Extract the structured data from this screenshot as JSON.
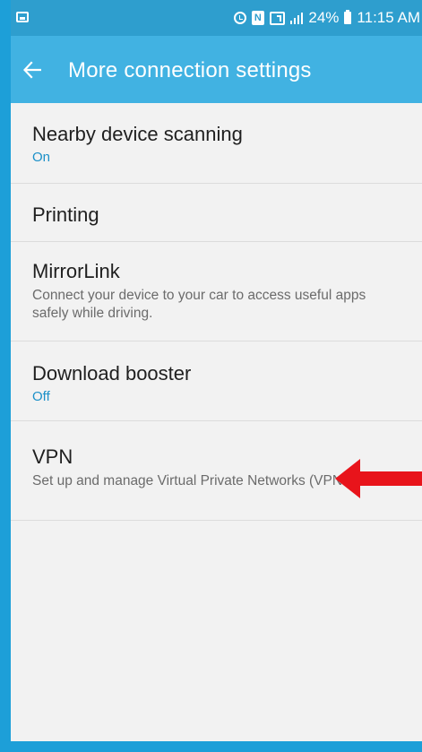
{
  "status_bar": {
    "battery_percent": "24%",
    "time": "11:15 AM",
    "icons": [
      "screenshot-icon",
      "alarm-icon",
      "nfc-icon",
      "sim-icon",
      "signal-icon",
      "battery-icon"
    ]
  },
  "app_bar": {
    "title": "More connection settings",
    "back_icon": "arrow-left-icon"
  },
  "settings": [
    {
      "title": "Nearby device scanning",
      "subtitle": "On",
      "subtitle_style": "accent"
    },
    {
      "title": "Printing",
      "subtitle": "",
      "subtitle_style": "none"
    },
    {
      "title": "MirrorLink",
      "subtitle": "Connect your device to your car to access useful apps safely while driving.",
      "subtitle_style": "normal"
    },
    {
      "title": "Download booster",
      "subtitle": "Off",
      "subtitle_style": "accent"
    },
    {
      "title": "VPN",
      "subtitle": "Set up and manage Virtual Private Networks (VPNs).",
      "subtitle_style": "normal"
    }
  ],
  "annotation": {
    "icon": "red-arrow-icon",
    "color": "#e8141b"
  },
  "colors": {
    "app_bar": "#41b2e2",
    "status_bar": "#2e9ece",
    "accent_text": "#1b90c8",
    "background": "#f2f2f2"
  }
}
